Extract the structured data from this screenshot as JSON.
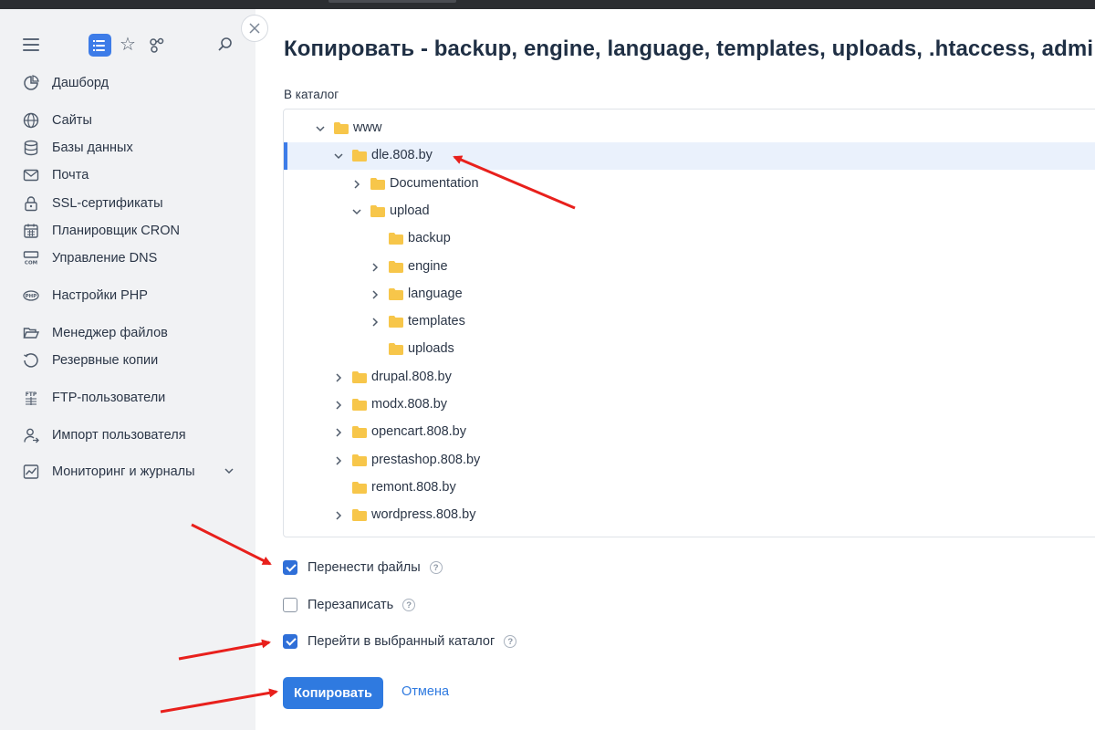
{
  "window": {
    "title": "Копировать - backup, engine, language, templates, uploads, .htaccess, admi"
  },
  "sidebar": {
    "toolbar": [
      {
        "icon": "hamburger-menu-icon"
      },
      {
        "icon": "list-view-icon",
        "active": true
      },
      {
        "icon": "star-icon"
      },
      {
        "icon": "nodes-icon"
      },
      {
        "icon": "search-icon"
      }
    ],
    "items": [
      {
        "label": "Дашборд",
        "icon": "dashboard-icon"
      },
      {
        "label": "Сайты",
        "icon": "globe-icon"
      },
      {
        "label": "Базы данных",
        "icon": "database-icon"
      },
      {
        "label": "Почта",
        "icon": "mail-icon"
      },
      {
        "label": "SSL-сертификаты",
        "icon": "lock-icon"
      },
      {
        "label": "Планировщик CRON",
        "icon": "calendar-icon"
      },
      {
        "label": "Управление DNS",
        "icon": "dns-icon"
      },
      {
        "label": "Настройки PHP",
        "icon": "php-icon"
      },
      {
        "label": "Менеджер файлов",
        "icon": "folder-open-icon"
      },
      {
        "label": "Резервные копии",
        "icon": "backup-icon"
      },
      {
        "label": "FTP-пользователи",
        "icon": "ftp-icon"
      },
      {
        "label": "Импорт пользователя",
        "icon": "user-import-icon"
      },
      {
        "label": "Мониторинг и журналы",
        "icon": "monitor-chart-icon",
        "expandable": true
      }
    ]
  },
  "form": {
    "directory_label": "В каталог",
    "tree": [
      {
        "name": "www",
        "expanded": true,
        "has_children": true
      },
      {
        "name": "dle.808.by",
        "expanded": true,
        "has_children": true,
        "selected": true
      },
      {
        "name": "Documentation",
        "expanded": false,
        "has_children": true
      },
      {
        "name": "upload",
        "expanded": true,
        "has_children": true
      },
      {
        "name": "backup",
        "has_children": false
      },
      {
        "name": "engine",
        "expanded": false,
        "has_children": true
      },
      {
        "name": "language",
        "expanded": false,
        "has_children": true
      },
      {
        "name": "templates",
        "expanded": false,
        "has_children": true
      },
      {
        "name": "uploads",
        "has_children": false
      },
      {
        "name": "drupal.808.by",
        "expanded": false,
        "has_children": true
      },
      {
        "name": "modx.808.by",
        "expanded": false,
        "has_children": true
      },
      {
        "name": "opencart.808.by",
        "expanded": false,
        "has_children": true
      },
      {
        "name": "prestashop.808.by",
        "expanded": false,
        "has_children": true
      },
      {
        "name": "remont.808.by",
        "has_children": false
      },
      {
        "name": "wordpress.808.by",
        "expanded": false,
        "has_children": true
      }
    ],
    "options": [
      {
        "label": "Перенести файлы",
        "checked": true,
        "help": "?"
      },
      {
        "label": "Перезаписать",
        "checked": false,
        "help": "?"
      },
      {
        "label": "Перейти в выбранный каталог",
        "checked": true,
        "help": "?"
      }
    ],
    "submit_label": "Копировать",
    "cancel_label": "Отмена"
  },
  "colors": {
    "accent": "#2f7ae0",
    "sidebar_bg": "#f1f2f4",
    "folder": "#f7c64a",
    "annotation_arrow": "#e8201c",
    "selected_row_bg": "#eaf1fc"
  }
}
